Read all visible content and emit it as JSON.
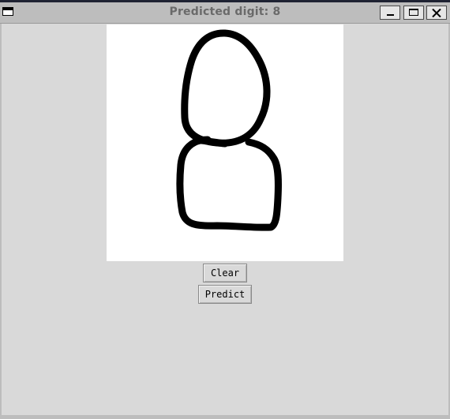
{
  "window": {
    "title": "Predicted digit: 8"
  },
  "titlebar": {
    "icons": {
      "menu": "window-menu-icon",
      "minimize": "minimize-icon",
      "maximize": "maximize-icon",
      "close": "close-icon"
    }
  },
  "canvas": {
    "background": "#ffffff",
    "stroke_color": "#000000",
    "drawing": "handwritten digit"
  },
  "buttons": {
    "clear_label": "Clear",
    "predict_label": "Predict"
  },
  "colors": {
    "window_bg": "#d9d9d9",
    "titlebar_bg": "#bdbdbd",
    "title_text": "#6a6a6a"
  }
}
